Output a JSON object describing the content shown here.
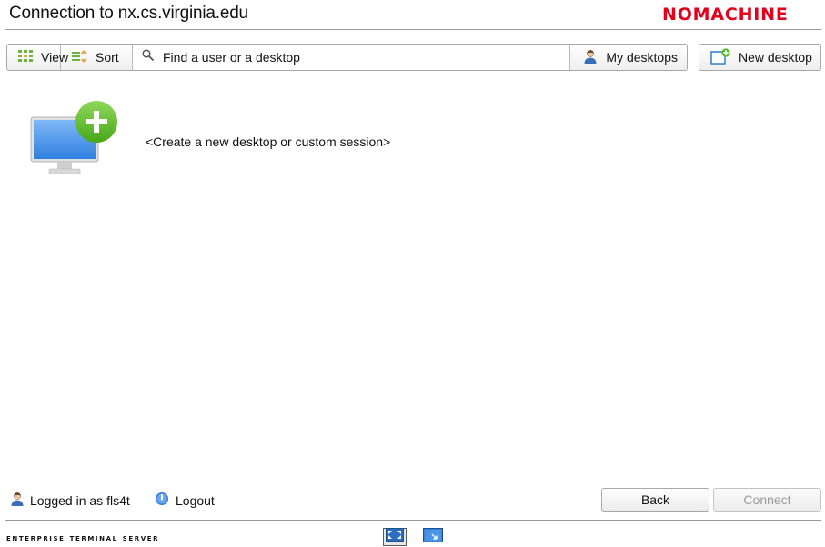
{
  "header": {
    "title": "Connection to nx.cs.virginia.edu",
    "brand": "NOMACHINE",
    "brand_color": "#e3001b"
  },
  "toolbar": {
    "view_label": "View",
    "sort_label": "Sort",
    "search_placeholder": "Find a user or a desktop",
    "search_value": "",
    "my_desktops_label": "My desktops",
    "new_desktop_label": "New desktop"
  },
  "main": {
    "new_item_label": "<Create a new desktop or custom session>"
  },
  "footer": {
    "logged_in_text": "Logged in as fls4t",
    "logout_label": "Logout",
    "back_label": "Back",
    "connect_label": "Connect",
    "edition": "Enterprise Terminal Server"
  },
  "icons": {
    "view": "grid-icon",
    "sort": "sort-icon",
    "search": "search-icon",
    "my_desktops": "user-icon",
    "new_desktop": "new-desktop-icon",
    "new_item": "monitor-plus-icon",
    "logged_in": "user-icon",
    "logout": "power-icon",
    "display_fit": "fit-display-icon",
    "display_resize": "resize-display-icon"
  },
  "colors": {
    "accent_green": "#5cb82a",
    "monitor_blue": "#3d8ee6"
  }
}
